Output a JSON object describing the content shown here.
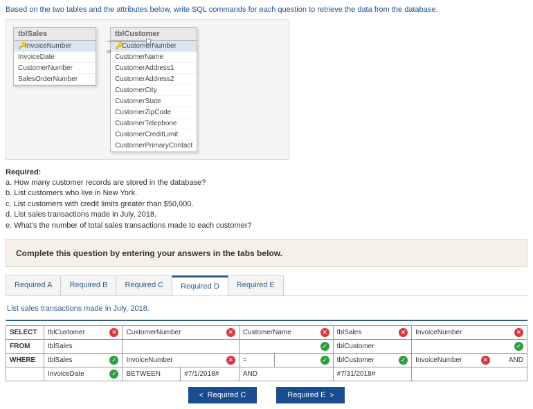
{
  "intro": "Based on the two tables and the attributes below, write SQL commands for each question to retrieve the data from the database.",
  "diagram": {
    "t1": {
      "name": "tblSales",
      "rows": [
        "InvoiceNumber",
        "InvoiceDate",
        "CustomerNumber",
        "SalesOrderNumber"
      ]
    },
    "t2": {
      "name": "tblCustomer",
      "rows": [
        "CustomerNumber",
        "CustomerName",
        "CustomerAddress1",
        "CustomerAddress2",
        "CustomerCity",
        "CustomerState",
        "CustomerZipCode",
        "CustomerTelephone",
        "CustomerCreditLimit",
        "CustomerPrimaryContact"
      ]
    },
    "rel": "∞"
  },
  "required": {
    "head": "Required:",
    "a": "a. How many customer records are stored in the database?",
    "b": "b. List customers who live in New York.",
    "c": "c. List customers with credit limits greater than $50,000.",
    "d": "d. List sales transactions made in July, 2018.",
    "e": "e. What's the number of total sales transactions made to each customer?"
  },
  "complete": "Complete this question by entering your answers in the tabs below.",
  "tabs": {
    "a": "Required A",
    "b": "Required B",
    "c": "Required C",
    "d": "Required D",
    "e": "Required E"
  },
  "subtitle": "List sales transactions made in July, 2018.",
  "rows": {
    "select": "SELECT",
    "from": "FROM",
    "where": "WHERE"
  },
  "cells": {
    "r1c1": "tblCustomer",
    "r1c2": "CustomerNumber",
    "r1c3": "CustomerName",
    "r1c4": "tblSales",
    "r1c5": "InvoiceNumber",
    "r2c1": "tblSales",
    "r2c3": "tblCustomer",
    "r3c1": "tblSales",
    "r3c2": "InvoiceNumber",
    "r3c3eq": "=",
    "r3c4": "tblCustomer",
    "r3c5": "InvoiceNumber",
    "r3c6": "AND",
    "r4c1": "InvoiceDate",
    "r4c2": "BETWEEN",
    "r4c3": "#7/1/2018#",
    "r4c4": "AND",
    "r4c5": "#7/31/2018#"
  },
  "nav": {
    "prev": "Required C",
    "next": "Required E"
  }
}
